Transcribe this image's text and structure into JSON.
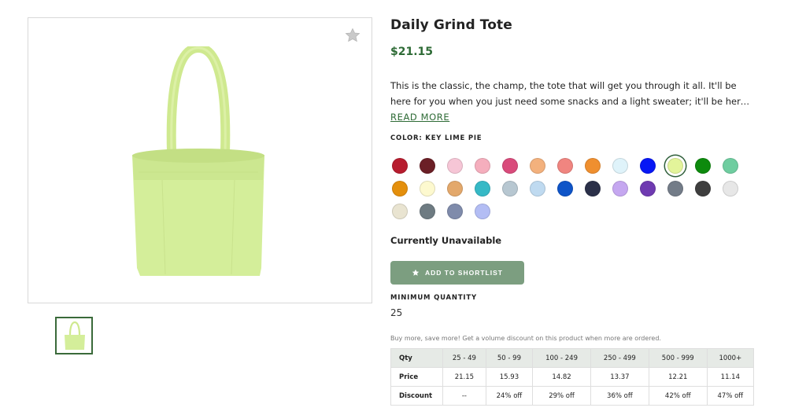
{
  "product": {
    "title": "Daily Grind Tote",
    "price": "$21.15",
    "description": "This is the classic, the champ, the tote that will get you through it all. It'll be here for you when you just need some snacks and a light sweater; it'll be here when you hav...",
    "read_more": "READ MORE",
    "color_label": "COLOR: KEY LIME PIE",
    "availability": "Currently Unavailable",
    "shortlist_button": "ADD TO SHORTLIST",
    "min_qty_label": "MINIMUM QUANTITY",
    "min_qty_value": "25",
    "volume_note": "Buy more, save more! Get a volume discount on this product when more are ordered.",
    "bag_color": "#d4ee9a"
  },
  "icons": {
    "favorite": "star-icon",
    "shortlist": "star-icon"
  },
  "swatches": [
    {
      "color": "#b71c2e"
    },
    {
      "color": "#6b1f26"
    },
    {
      "color": "#f6c6d6"
    },
    {
      "color": "#f5aebd"
    },
    {
      "color": "#d94b7b"
    },
    {
      "color": "#f3b17d"
    },
    {
      "color": "#f08580"
    },
    {
      "color": "#ef8f2f"
    },
    {
      "color": "#dff3fa"
    },
    {
      "color": "#0717f5"
    },
    {
      "color": "#e3f49a",
      "selected": true
    },
    {
      "color": "#0d8a0d"
    },
    {
      "color": "#6fcda0"
    },
    {
      "color": "#e48f0c"
    },
    {
      "color": "#fdf9cf"
    },
    {
      "color": "#e3a86b"
    },
    {
      "color": "#36b9c6"
    },
    {
      "color": "#b7c7d1"
    },
    {
      "color": "#bfdaf0"
    },
    {
      "color": "#0e54c8"
    },
    {
      "color": "#2b3049"
    },
    {
      "color": "#c5a7f0"
    },
    {
      "color": "#6f3ab1"
    },
    {
      "color": "#737c88"
    },
    {
      "color": "#3e3e3e"
    },
    {
      "color": "#e7e7e7"
    },
    {
      "color": "#e9e4d1"
    },
    {
      "color": "#6e7b82"
    },
    {
      "color": "#7f8bab"
    },
    {
      "color": "#b3bdf4"
    }
  ],
  "pricing": {
    "headers": [
      "Qty",
      "25 - 49",
      "50 - 99",
      "100 - 249",
      "250 - 499",
      "500 - 999",
      "1000+"
    ],
    "price": [
      "Price",
      "21.15",
      "15.93",
      "14.82",
      "13.37",
      "12.21",
      "11.14"
    ],
    "discount": [
      "Discount",
      "--",
      "24% off",
      "29% off",
      "36% off",
      "42% off",
      "47% off"
    ]
  }
}
